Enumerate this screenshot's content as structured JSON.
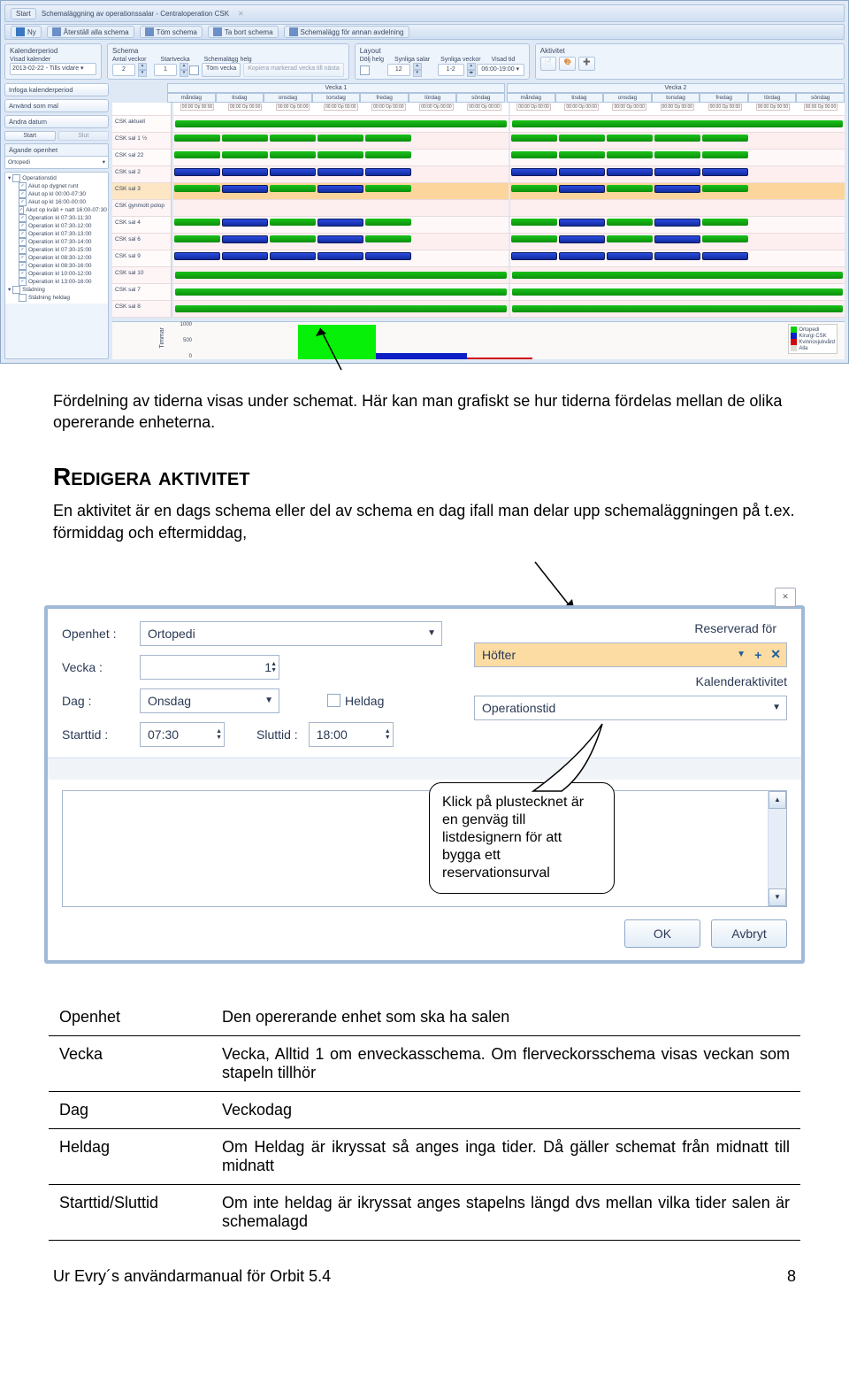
{
  "app": {
    "windowTitle": "Schemaläggning av operationssalar - Centraloperation CSK",
    "startBtn": "Start",
    "menu": [
      "Ny",
      "Återställ alla schema",
      "Töm schema",
      "Ta bort schema",
      "Schemalägg för annan avdelning"
    ]
  },
  "ribbon": {
    "kalenderperiod": {
      "title": "Kalenderperiod",
      "visadLabel": "Visad kalender",
      "visad": "2013-02-22 - Tills vidare"
    },
    "schema": {
      "title": "Schema",
      "antalVeckorLabel": "Antal veckor",
      "antalVeckor": "2",
      "startveckaLabel": "Startvecka",
      "startvecka": "1",
      "schemalagghelgLabel": "Schemalägg helg",
      "tomVecka": "Töm vecka",
      "kopiera": "Kopiera markerad vecka till nästa"
    },
    "layout": {
      "title": "Layout",
      "doljHelg": "Dölj helg",
      "synligaSalarLabel": "Synliga salar",
      "synligaSalar": "12",
      "synligaVeckorLabel": "Synliga veckor",
      "synligaVeckor": "1-2",
      "visadTidLabel": "Visad tid",
      "visadTid": "06:00-19:00"
    },
    "aktivitet": {
      "title": "Aktivitet"
    }
  },
  "sidebar": {
    "buttons": [
      "Infoga kalenderperiod",
      "Använd som mal",
      "Ändra datum"
    ],
    "startBtn": "Start",
    "slutBtn": "Slut",
    "agandePanel": "Ägande openhet",
    "ortopedi": "Ortopedi",
    "treeOpTitle": "Operationstid",
    "treeItems": [
      "Akut op dygnet runt",
      "Akut op kl 00:00-07:30",
      "Akut op kl 16:00-00:00",
      "Akut op kväll + natt 16:00-07:30",
      "Operation kl 07:30-11:30",
      "Operation kl 07:30-12:00",
      "Operation kl 07:30-13:00",
      "Operation kl 07:30-14:00",
      "Operation kl 07:30-15:00",
      "Operation kl 08:30-12:00",
      "Operation kl 08:30-16:00",
      "Operation kl 10:00-12:00",
      "Operation kl 13:00-16:00"
    ],
    "stadning": "Städning",
    "stadningHeldag": "Städning heldag"
  },
  "grid": {
    "weekTitles": [
      "Vecka 1",
      "Vecka 2"
    ],
    "days": [
      "måndag",
      "tisdag",
      "onsdag",
      "torsdag",
      "fredag",
      "lördag",
      "söndag"
    ],
    "timeCell": "00:00 Op 00:00",
    "allCell": "00:00 0 - 00:00",
    "rows": [
      "CSK aktuell",
      "CSK sal 1 ½",
      "CSK sal 22",
      "CSK sal 2",
      "CSK sal 3",
      "CSK gynmott polop",
      "CSK sal 4",
      "CSK sal 6",
      "CSK sal 9",
      "CSK sal 10",
      "CSK sal 7",
      "CSK sal 8"
    ]
  },
  "chart_data": {
    "type": "bar",
    "ylabel": "Timmar",
    "yticks": [
      0,
      500,
      1000
    ],
    "series": [
      {
        "name": "Ortopedi",
        "color": "#07d007"
      },
      {
        "name": "Kirurgi CSK",
        "color": "#0b1fc4"
      },
      {
        "name": "Kvinnosjukvård",
        "color": "#d20808"
      },
      {
        "name": "Alla",
        "color": "#e0ddd8"
      }
    ]
  },
  "doc": {
    "p1": "Fördelning av tiderna visas under schemat. Här kan man grafiskt se hur tiderna fördelas mellan de olika opererande enheterna.",
    "h2": "Redigera aktivitet",
    "p2": "En aktivitet är en dags schema eller del av schema en dag ifall man delar upp schemaläggningen på t.ex. förmiddag och eftermiddag,"
  },
  "dialog": {
    "close": "✕",
    "openhetLabel": "Openhet :",
    "openhet": "Ortopedi",
    "veckaLabel": "Vecka :",
    "vecka": "1",
    "dagLabel": "Dag :",
    "dag": "Onsdag",
    "heldagLabel": "Heldag",
    "starttidLabel": "Starttid :",
    "starttid": "07:30",
    "sluttidLabel": "Sluttid :",
    "sluttid": "18:00",
    "reservLabel": "Reserverad för",
    "reservValue": "Höfter",
    "kalAktLabel": "Kalenderaktivitet",
    "kalAkt": "Operationstid",
    "ok": "OK",
    "avbryt": "Avbryt"
  },
  "callout": "Klick på plustecknet är en genväg till listdesignern för att bygga ett reservationsurval",
  "table": {
    "rows": [
      {
        "k": "Openhet",
        "v": "Den opererande enhet som ska ha salen"
      },
      {
        "k": "Vecka",
        "v": "Vecka, Alltid 1 om enveckasschema. Om flerveckorsschema visas veckan som stapeln tillhör"
      },
      {
        "k": "Dag",
        "v": "Veckodag"
      },
      {
        "k": "Heldag",
        "v": "Om Heldag är ikryssat så anges inga tider. Då gäller schemat från midnatt till midnatt"
      },
      {
        "k": "Starttid/Sluttid",
        "v": "Om inte heldag är ikryssat anges stapelns längd dvs mellan vilka tider salen är schemalagd"
      }
    ]
  },
  "footer": {
    "left": "Ur Evry´s användarmanual för Orbit 5.4",
    "right": "8"
  }
}
